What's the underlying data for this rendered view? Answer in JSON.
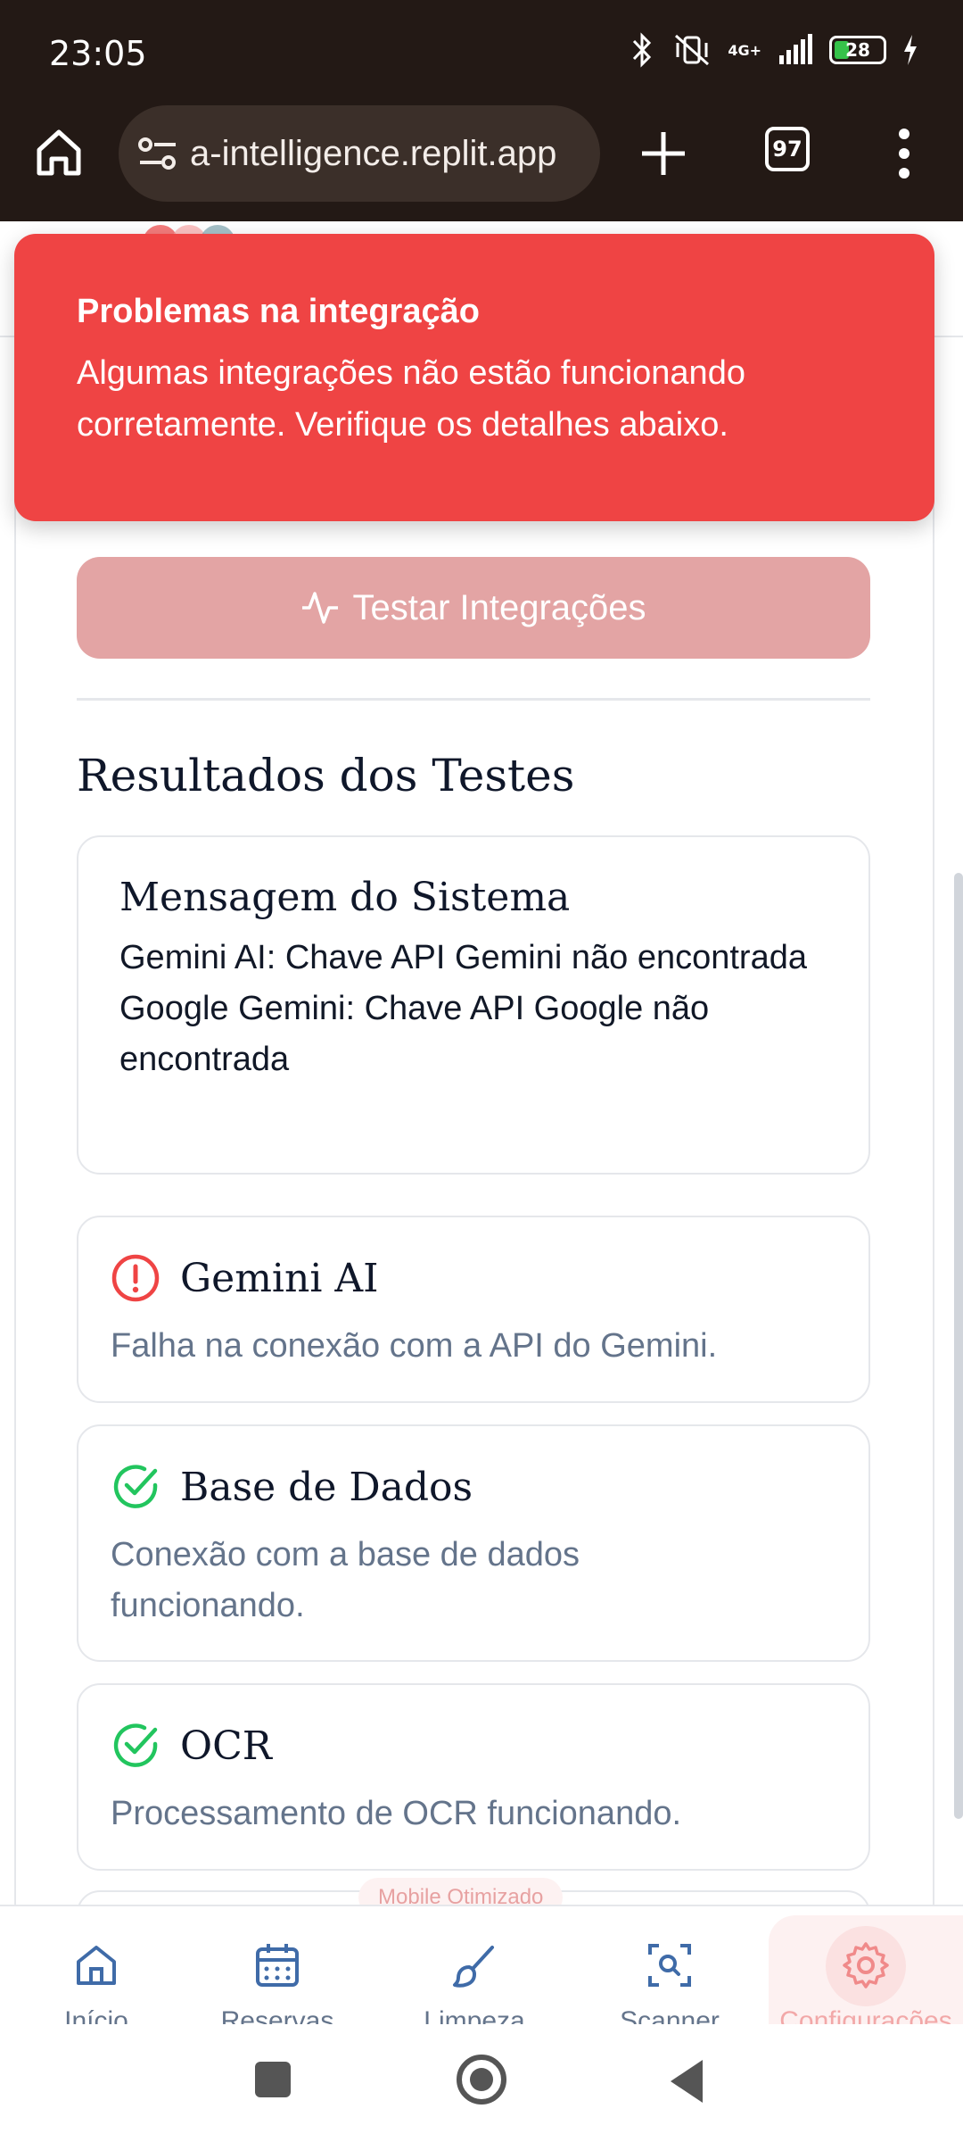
{
  "status_bar": {
    "time": "23:05",
    "network": "4G+",
    "battery": "28",
    "icons": [
      "bluetooth-icon",
      "mute-vibrate-icon",
      "signal-icon",
      "battery-icon",
      "charging-icon"
    ]
  },
  "browser": {
    "url": "a-intelligence.replit.app",
    "tab_count": "97"
  },
  "toast": {
    "title": "Problemas na integração",
    "body": "Algumas integrações não estão funcionando corretamente. Verifique os detalhes abaixo."
  },
  "main": {
    "test_button_label": "Testar Integrações",
    "section_title": "Resultados dos Testes",
    "system_message": {
      "title": "Mensagem do Sistema",
      "lines": [
        "Gemini AI: Chave API Gemini não encontrada",
        "Google Gemini: Chave API Google não encontrada"
      ]
    },
    "results": [
      {
        "name": "Gemini AI",
        "status": "error",
        "description": "Falha na conexão com a API do Gemini."
      },
      {
        "name": "Base de Dados",
        "status": "ok",
        "description": "Conexão com a base de dados funcionando."
      },
      {
        "name": "OCR",
        "status": "ok",
        "description": "Processamento de OCR funcionando."
      }
    ],
    "mobile_badge": "Mobile Otimizado"
  },
  "bottom_nav": {
    "items": [
      {
        "label": "Início",
        "icon": "home-icon"
      },
      {
        "label": "Reservas",
        "icon": "calendar-icon"
      },
      {
        "label": "Limpeza",
        "icon": "brush-icon"
      },
      {
        "label": "Scanner",
        "icon": "scan-icon"
      },
      {
        "label": "Configurações",
        "icon": "gear-icon",
        "active": true
      }
    ]
  },
  "colors": {
    "error": "#ef4444",
    "success": "#22c55e",
    "button": "#e3a4a4",
    "browser_chrome": "#231915"
  }
}
